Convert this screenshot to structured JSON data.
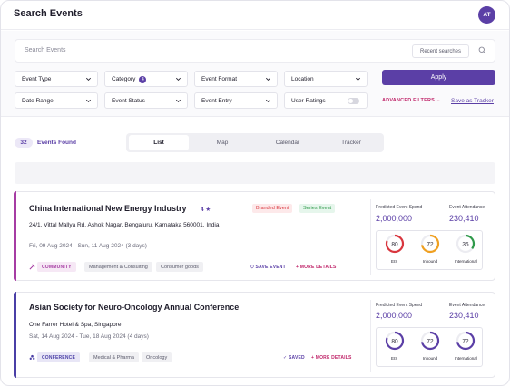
{
  "header": {
    "title": "Search Events",
    "avatar_initials": "AT"
  },
  "search": {
    "placeholder": "Search Events",
    "recent_label": "Recent searches",
    "icon": "search-icon"
  },
  "filters": {
    "row1": [
      "Event Type",
      "Category",
      "Event Format",
      "Location"
    ],
    "row2": [
      "Date Range",
      "Event Status",
      "Event Entry",
      "User Ratings"
    ],
    "category_count": "4",
    "apply_label": "Apply",
    "advanced_label": "ADVANCED FILTERS",
    "save_tracker_label": "Save as Tracker"
  },
  "results": {
    "count": "32",
    "label": "Events Found"
  },
  "view_tabs": [
    "List",
    "Map",
    "Calendar",
    "Tracker"
  ],
  "colors": {
    "brand": "#5b3fa6",
    "accent_pink": "#c0266a",
    "card1_accent": "#a63ca3",
    "card2_accent": "#4a3fa6"
  },
  "events": [
    {
      "title": "China International New Energy Industry",
      "rating": "4 ★",
      "address": "24/1, Vittal Mallya Rd, Ashok Nagar, Bengaluru, Karnataka 560001, India",
      "dates": "Fri, 09 Aug 2024 - Sun, 11 Aug 2024 (3 days)",
      "type_tag": "COMMUNITY",
      "tags": [
        "Management & Consulting",
        "Consumer goods"
      ],
      "badges": [
        "Branded Event",
        "Series Event"
      ],
      "save_label": "SAVE EVENT",
      "more_label": "MORE DETAILS",
      "spend_label": "Predicted Event Spend",
      "spend_value": "2,000,000",
      "attendance_label": "Event Attendance",
      "attendance_value": "230,410",
      "gauges": [
        {
          "value": "80",
          "label": "EIS",
          "color": "#d9363e",
          "pct": 0.8
        },
        {
          "value": "72",
          "label": "Inbound",
          "color": "#f0a020",
          "pct": 0.72
        },
        {
          "value": "35",
          "label": "International",
          "color": "#2f9a4a",
          "pct": 0.35
        }
      ]
    },
    {
      "title": "Asian Society for Neuro-Oncology Annual Conference",
      "address": "One Farrer Hotel & Spa, Singapore",
      "dates": "Sat, 14 Aug 2024 - Tue, 18 Aug 2024 (4 days)",
      "type_tag": "CONFERENCE",
      "tags": [
        "Medical & Pharma",
        "Oncology"
      ],
      "save_label": "SAVED",
      "more_label": "MORE DETAILS",
      "spend_label": "Predicted Event Spend",
      "spend_value": "2,000,000",
      "attendance_label": "Event Attendance",
      "attendance_value": "230,410",
      "gauges": [
        {
          "value": "80",
          "label": "EIS",
          "color": "#5b3fa6",
          "pct": 0.8
        },
        {
          "value": "72",
          "label": "Inbound",
          "color": "#5b3fa6",
          "pct": 0.72
        },
        {
          "value": "72",
          "label": "International",
          "color": "#5b3fa6",
          "pct": 0.72
        }
      ]
    }
  ]
}
